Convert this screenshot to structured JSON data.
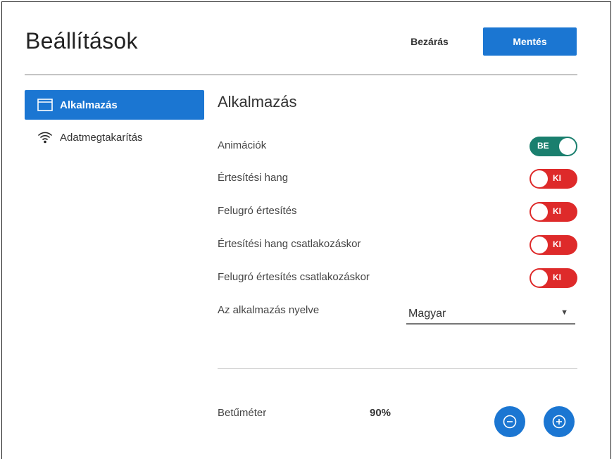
{
  "header": {
    "title": "Beállítások",
    "close_label": "Bezárás",
    "save_label": "Mentés"
  },
  "sidebar": {
    "items": [
      {
        "label": "Alkalmazás",
        "icon": "window-icon",
        "active": true
      },
      {
        "label": "Adatmegtakarítás",
        "icon": "wifi-icon",
        "active": false
      }
    ]
  },
  "main": {
    "section_title": "Alkalmazás",
    "settings": [
      {
        "label": "Animációk",
        "state": "BE",
        "on": true
      },
      {
        "label": "Értesítési hang",
        "state": "KI",
        "on": false
      },
      {
        "label": "Felugró értesítés",
        "state": "KI",
        "on": false
      },
      {
        "label": "Értesítési hang csatlakozáskor",
        "state": "KI",
        "on": false
      },
      {
        "label": "Felugró értesítés csatlakozáskor",
        "state": "KI",
        "on": false
      }
    ],
    "language": {
      "label": "Az alkalmazás nyelve",
      "value": "Magyar"
    },
    "font_size": {
      "label": "Betűméter",
      "value": "90%"
    }
  },
  "colors": {
    "accent": "#1b76d2",
    "toggle_on": "#1a7f6e",
    "toggle_off": "#de2a2a"
  }
}
